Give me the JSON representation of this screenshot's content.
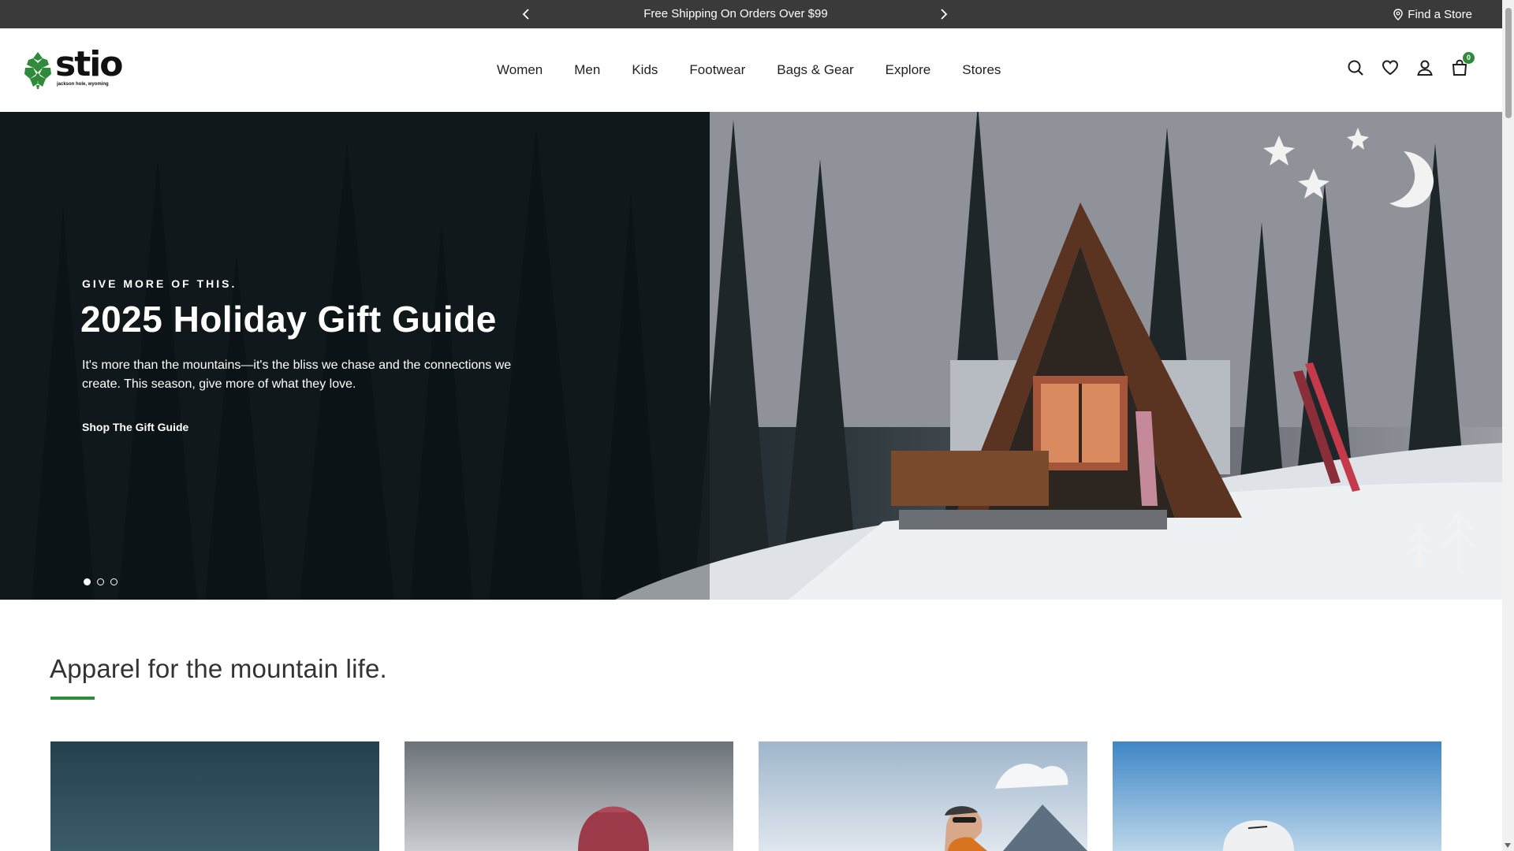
{
  "promo_bar": {
    "message": "Free Shipping On Orders Over $99",
    "find_store": "Find a Store"
  },
  "header": {
    "logo_word": "stio",
    "logo_tagline": "jackson hole, wyoming",
    "nav": [
      "Women",
      "Men",
      "Kids",
      "Footwear",
      "Bags & Gear",
      "Explore",
      "Stores"
    ],
    "icons": [
      "search-icon",
      "heart-icon",
      "account-icon",
      "bag-icon"
    ],
    "cart_count": "0"
  },
  "hero": {
    "eyebrow": "GIVE MORE OF THIS.",
    "title": "2025 Holiday Gift Guide",
    "body": "It's more than the mountains—it's the bliss we chase and the connections we create. This season, give more of what they love.",
    "cta": "Shop The Gift Guide",
    "slides_total": 3,
    "active_slide": 1
  },
  "section": {
    "title": "Apparel for the mountain life."
  },
  "colors": {
    "promo_bg": "#3a3a3a",
    "accent_green": "#2f8a3c",
    "text_dark": "#1f1f1f"
  }
}
